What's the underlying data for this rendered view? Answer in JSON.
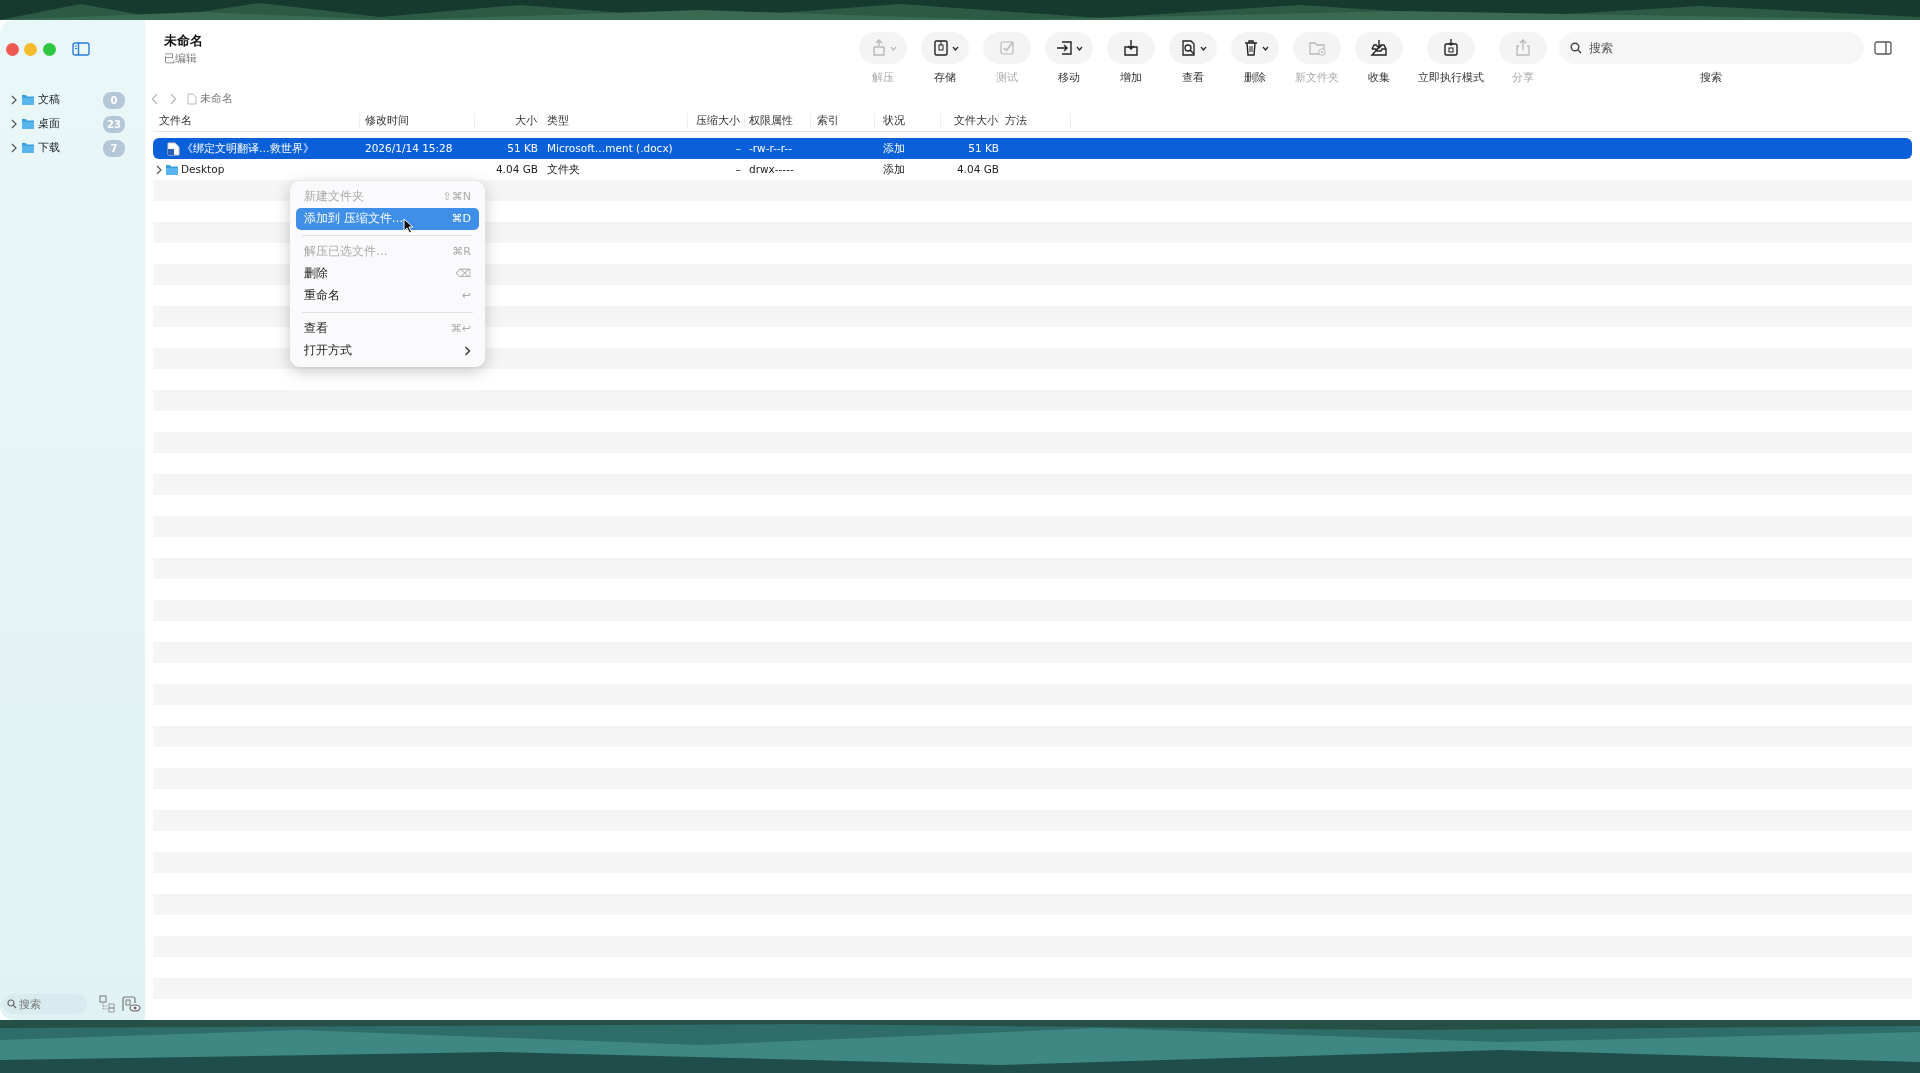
{
  "window": {
    "title": "未命名",
    "subtitle": "已编辑"
  },
  "toolbar": [
    {
      "kind": "extract",
      "label": "解压",
      "disabled": true,
      "dropdown": true
    },
    {
      "kind": "store",
      "label": "存储",
      "disabled": false,
      "dropdown": true
    },
    {
      "kind": "test",
      "label": "测试",
      "disabled": true,
      "dropdown": false
    },
    {
      "kind": "move",
      "label": "移动",
      "disabled": false,
      "dropdown": true
    },
    {
      "kind": "add",
      "label": "增加",
      "disabled": false,
      "dropdown": false
    },
    {
      "kind": "view",
      "label": "查看",
      "disabled": false,
      "dropdown": true
    },
    {
      "kind": "delete",
      "label": "删除",
      "disabled": false,
      "dropdown": true
    },
    {
      "kind": "newfolder",
      "label": "新文件夹",
      "disabled": true,
      "dropdown": false
    },
    {
      "kind": "collect",
      "label": "收集",
      "disabled": false,
      "dropdown": false
    },
    {
      "kind": "run",
      "label": "立即执行模式",
      "disabled": false,
      "dropdown": false
    },
    {
      "kind": "share",
      "label": "分享",
      "disabled": true,
      "dropdown": false
    }
  ],
  "search": {
    "placeholder": "搜索",
    "label": "搜索"
  },
  "sidebar": {
    "items": [
      {
        "label": "文稿",
        "count": "0",
        "expanded": false
      },
      {
        "label": "桌面",
        "count": "23",
        "expanded": false
      },
      {
        "label": "下载",
        "count": "7",
        "expanded": false
      }
    ],
    "search": {
      "placeholder": "搜索"
    }
  },
  "breadcrumb": "未命名",
  "table": {
    "columns": [
      "文件名",
      "修改时间",
      "大小",
      "类型",
      "压缩大小",
      "权限属性",
      "索引",
      "状况",
      "文件大小",
      "方法"
    ],
    "rows": [
      {
        "kind": "file",
        "selected": true,
        "cells": [
          "《绑定文明翻译…救世界》",
          "2026/1/14 15:28",
          "51 KB",
          "Microsoft…ment (.docx)",
          "–",
          "-rw-r--r--",
          "",
          "添加",
          "51 KB",
          ""
        ]
      },
      {
        "kind": "folder",
        "selected": false,
        "cells": [
          "Desktop",
          "",
          "4.04 GB",
          "文件夹",
          "–",
          "drwx-----",
          "",
          "添加",
          "4.04 GB",
          ""
        ]
      }
    ]
  },
  "context_menu": {
    "groups": [
      [
        {
          "label": "新建文件夹",
          "shortcut": "⇧⌘N",
          "disabled": true,
          "selected": false,
          "submenu": false
        },
        {
          "label": "添加到 压缩文件…",
          "shortcut": "⌘D",
          "disabled": false,
          "selected": true,
          "submenu": false
        }
      ],
      [
        {
          "label": "解压已选文件…",
          "shortcut": "⌘R",
          "disabled": true,
          "selected": false,
          "submenu": false
        },
        {
          "label": "删除",
          "shortcut": "⌫",
          "disabled": false,
          "selected": false,
          "submenu": false
        },
        {
          "label": "重命名",
          "shortcut": "↩",
          "disabled": false,
          "selected": false,
          "submenu": false
        }
      ],
      [
        {
          "label": "查看",
          "shortcut": "⌘↩",
          "disabled": false,
          "selected": false,
          "submenu": false
        },
        {
          "label": "打开方式",
          "disabled": false,
          "selected": false,
          "submenu": true
        }
      ]
    ]
  }
}
